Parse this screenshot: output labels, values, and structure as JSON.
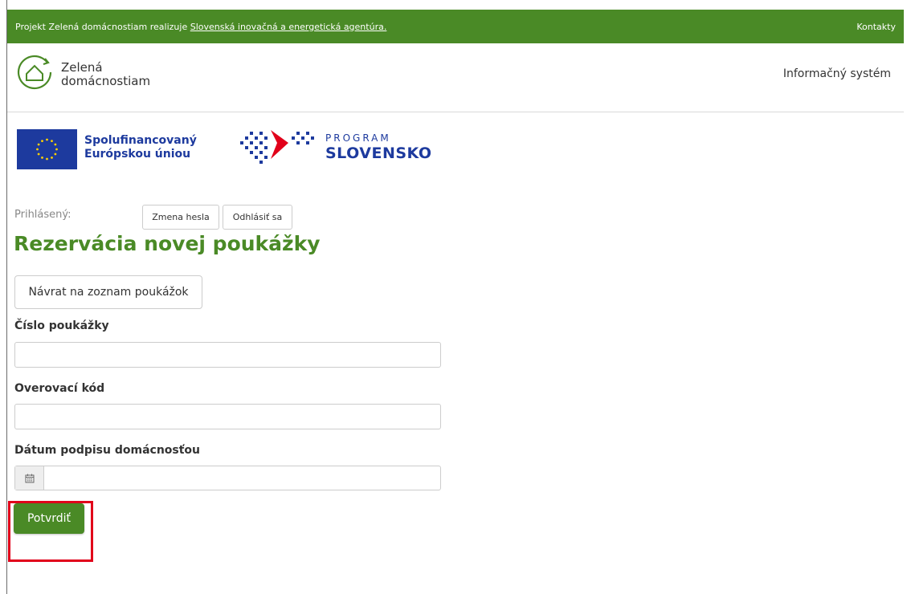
{
  "topbar": {
    "prefix": "Projekt Zelená domácnostiam realizuje ",
    "agency_link": "Slovenská inovačná a energetická agentúra.",
    "contacts": "Kontakty"
  },
  "header": {
    "logo_line1": "Zelená",
    "logo_line2": "domácnostiam",
    "info_system": "Informačný systém"
  },
  "partners": {
    "eu_line1": "Spolufinancovaný",
    "eu_line2": "Európskou úniou",
    "program_line1": "PROGRAM",
    "program_line2": "SLOVENSKO"
  },
  "user": {
    "logged_label": "Prihlásený:",
    "change_password": "Zmena hesla",
    "logout": "Odhlásiť sa"
  },
  "page": {
    "title": "Rezervácia novej poukážky",
    "back_button": "Návrat na zoznam poukážok"
  },
  "form": {
    "voucher_label": "Číslo poukážky",
    "voucher_value": "",
    "code_label": "Overovací kód",
    "code_value": "",
    "date_label": "Dátum podpisu domácnosťou",
    "date_value": "",
    "submit": "Potvrdiť"
  },
  "colors": {
    "brand_green": "#4a8a26",
    "eu_blue": "#1d3a9e",
    "highlight_red": "#e1001a"
  }
}
